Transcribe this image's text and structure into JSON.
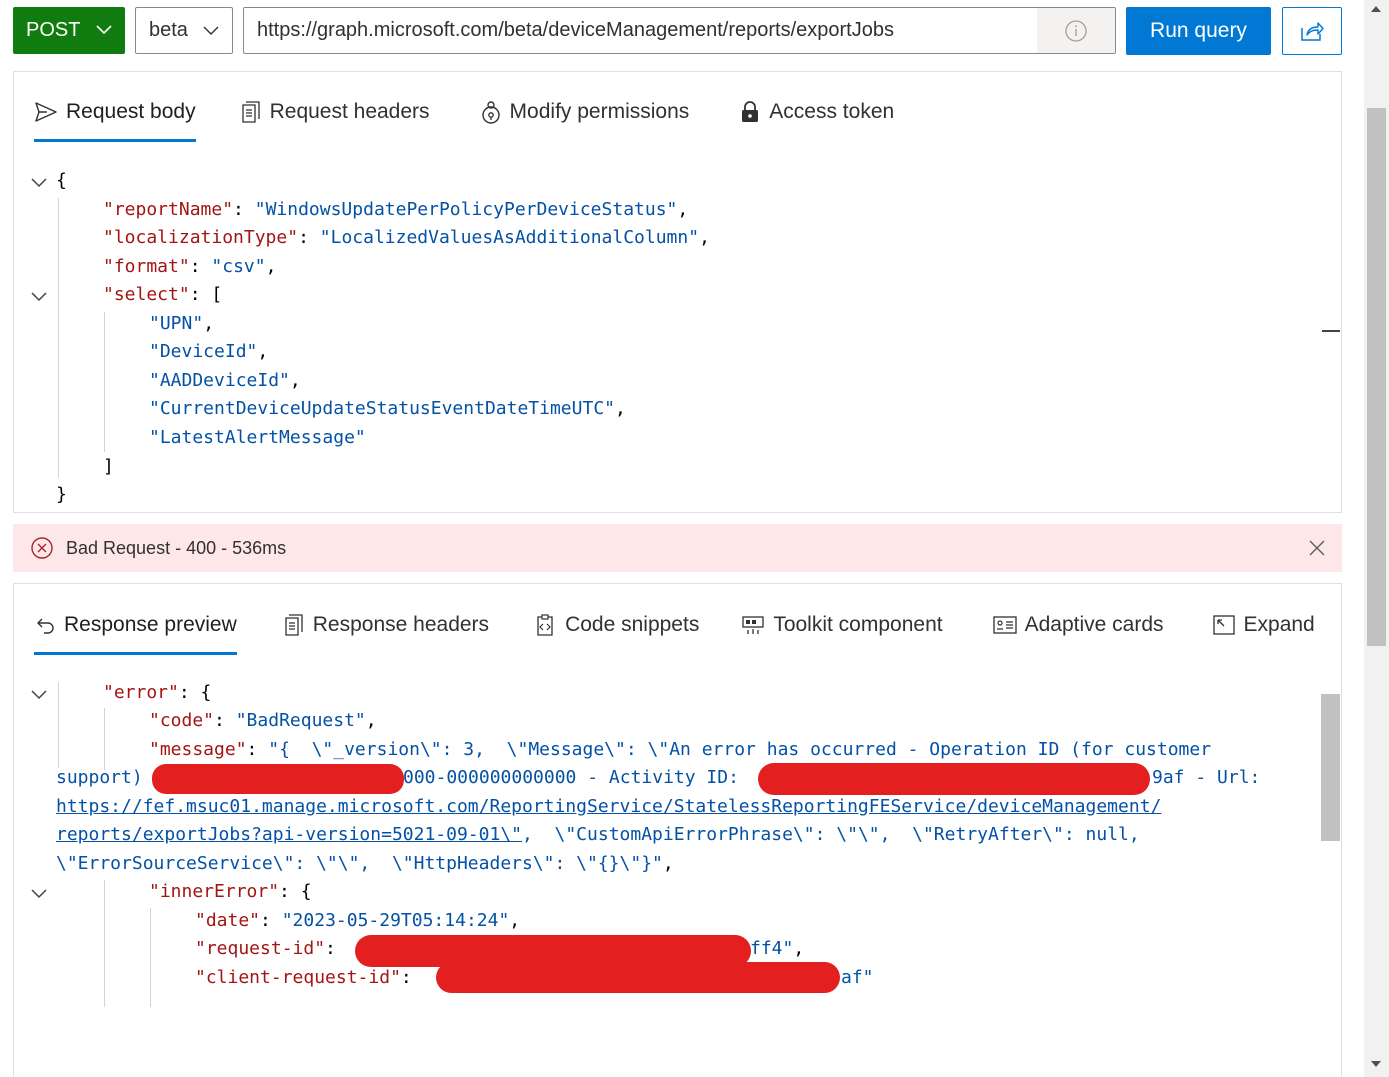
{
  "toolbar": {
    "method": "POST",
    "version": "beta",
    "url": "https://graph.microsoft.com/beta/deviceManagement/reports/exportJobs",
    "run_label": "Run query"
  },
  "request_tabs": [
    {
      "label": "Request body",
      "icon": "send-icon",
      "active": true
    },
    {
      "label": "Request headers",
      "icon": "document-icon",
      "active": false
    },
    {
      "label": "Modify permissions",
      "icon": "permissions-icon",
      "active": false
    },
    {
      "label": "Access token",
      "icon": "lock-icon",
      "active": false
    }
  ],
  "request_body": {
    "open_brace": "{",
    "reportName_key": "\"reportName\"",
    "reportName_value": "\"WindowsUpdatePerPolicyPerDeviceStatus\"",
    "localizationType_key": "\"localizationType\"",
    "localizationType_value": "\"LocalizedValuesAsAdditionalColumn\"",
    "format_key": "\"format\"",
    "format_value": "\"csv\"",
    "select_key": "\"select\"",
    "select_items": [
      "\"UPN\"",
      "\"DeviceId\"",
      "\"AADDeviceId\"",
      "\"CurrentDeviceUpdateStatusEventDateTimeUTC\"",
      "\"LatestAlertMessage\""
    ],
    "close_bracket": "]",
    "close_brace": "}"
  },
  "status": {
    "text": "Bad Request - 400 - 536ms",
    "color": "#fde7e9"
  },
  "response_tabs": [
    {
      "label": "Response preview",
      "icon": "undo-icon",
      "active": true
    },
    {
      "label": "Response headers",
      "icon": "document-icon",
      "active": false
    },
    {
      "label": "Code snippets",
      "icon": "code-snippet-icon",
      "active": false
    },
    {
      "label": "Toolkit component",
      "icon": "toolkit-icon",
      "active": false
    },
    {
      "label": "Adaptive cards",
      "icon": "card-icon",
      "active": false
    },
    {
      "label": "Expand",
      "icon": "expand-icon",
      "active": false
    }
  ],
  "response_body": {
    "error_key": "\"error\"",
    "code_key": "\"code\"",
    "code_value": "\"BadRequest\"",
    "message_key": "\"message\"",
    "message_line1": "\"{  \\\"_version\\\": 3,  \\\"Message\\\": \\\"An error has occurred - Operation ID (for customer",
    "message_line2a": "support)",
    "message_line2b": "000-000000000000 - Activity ID:",
    "message_line2c": "9af - Url:",
    "message_url_line1": "https://fef.msuc01.manage.microsoft.com/ReportingService/StatelessReportingFEService/deviceManagement/",
    "message_url_line2": "reports/exportJobs?api-version=5021-09-01\\\"",
    "message_line3_rest": ",  \\\"CustomApiErrorPhrase\\\": \\\"\\\",  \\\"RetryAfter\\\": null,",
    "message_line4": "\\\"ErrorSourceService\\\": \\\"\\\",  \\\"HttpHeaders\\\": \\\"{}\\\"}\"",
    "innerError_key": "\"innerError\"",
    "date_key": "\"date\"",
    "date_value": "\"2023-05-29T05:14:24\"",
    "request_id_key": "\"request-id\"",
    "request_id_tail": "ff4\"",
    "client_request_id_key": "\"client-request-id\"",
    "client_request_id_tail": "af\""
  },
  "colors": {
    "method_green": "#107c10",
    "accent_blue": "#0078d4",
    "json_key": "#a31515",
    "json_string": "#0451a5",
    "error_bg": "#fde7e9",
    "redaction": "#e3201f"
  }
}
